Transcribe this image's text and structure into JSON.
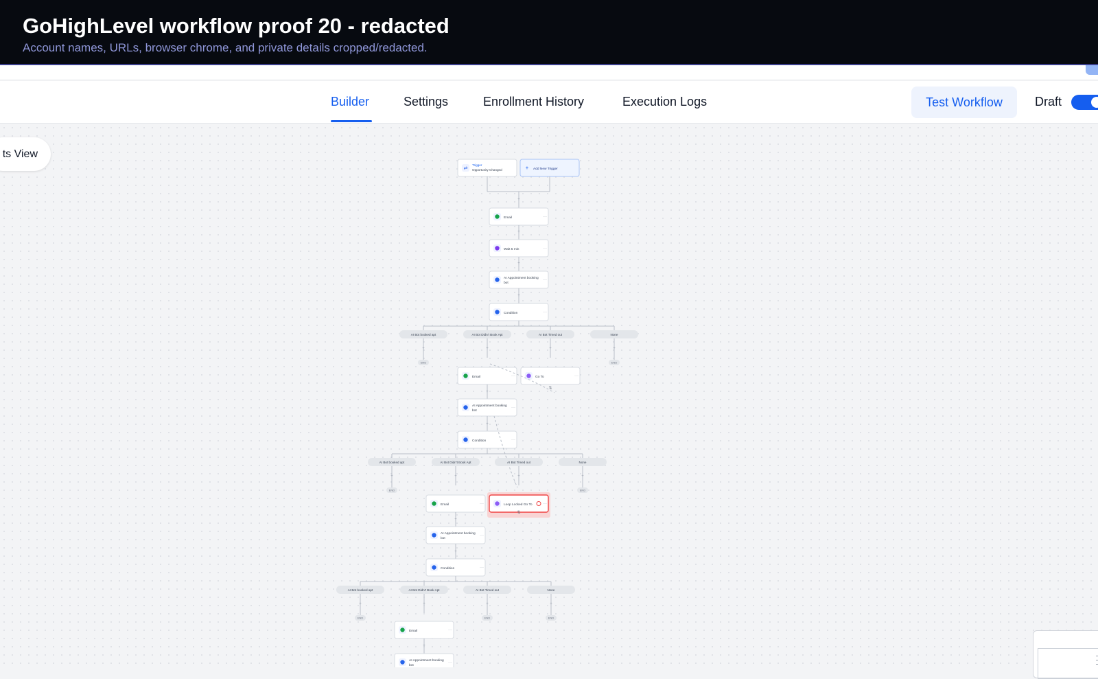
{
  "banner": {
    "title": "GoHighLevel workflow proof 20 - redacted",
    "subtitle": "Account names, URLs, browser chrome, and private details cropped/redacted."
  },
  "nav": {
    "tabs": [
      {
        "label": "Builder",
        "active": true
      },
      {
        "label": "Settings",
        "active": false
      },
      {
        "label": "Enrollment History",
        "active": false
      },
      {
        "label": "Execution Logs",
        "active": false
      }
    ],
    "test_button": "Test Workflow",
    "status_label": "Draft",
    "status_toggle_on": true
  },
  "canvas": {
    "view_button": "ts View",
    "trigger": {
      "title": "Trigger",
      "subtitle": "Opportunity Changed"
    },
    "add_trigger": "Add New Trigger",
    "steps": {
      "email": "Email",
      "wait": "Wait 5 min",
      "ai_bot": "AI Appointment booking bot",
      "condition": "Condition",
      "goto": "Go To",
      "loop_locked": "Loop Locked Go To",
      "end": "END"
    },
    "branches": [
      "AI Bot booked apt",
      "AI Bot Didn't Book Apt",
      "AI Bot Timed out",
      "None"
    ]
  },
  "colors": {
    "accent": "#155eef",
    "email_icon": "#16a34a",
    "wait_icon": "#7c3aed",
    "bot_icon": "#2563eb",
    "goto_icon": "#8b5cf6",
    "error": "#ef4444"
  }
}
